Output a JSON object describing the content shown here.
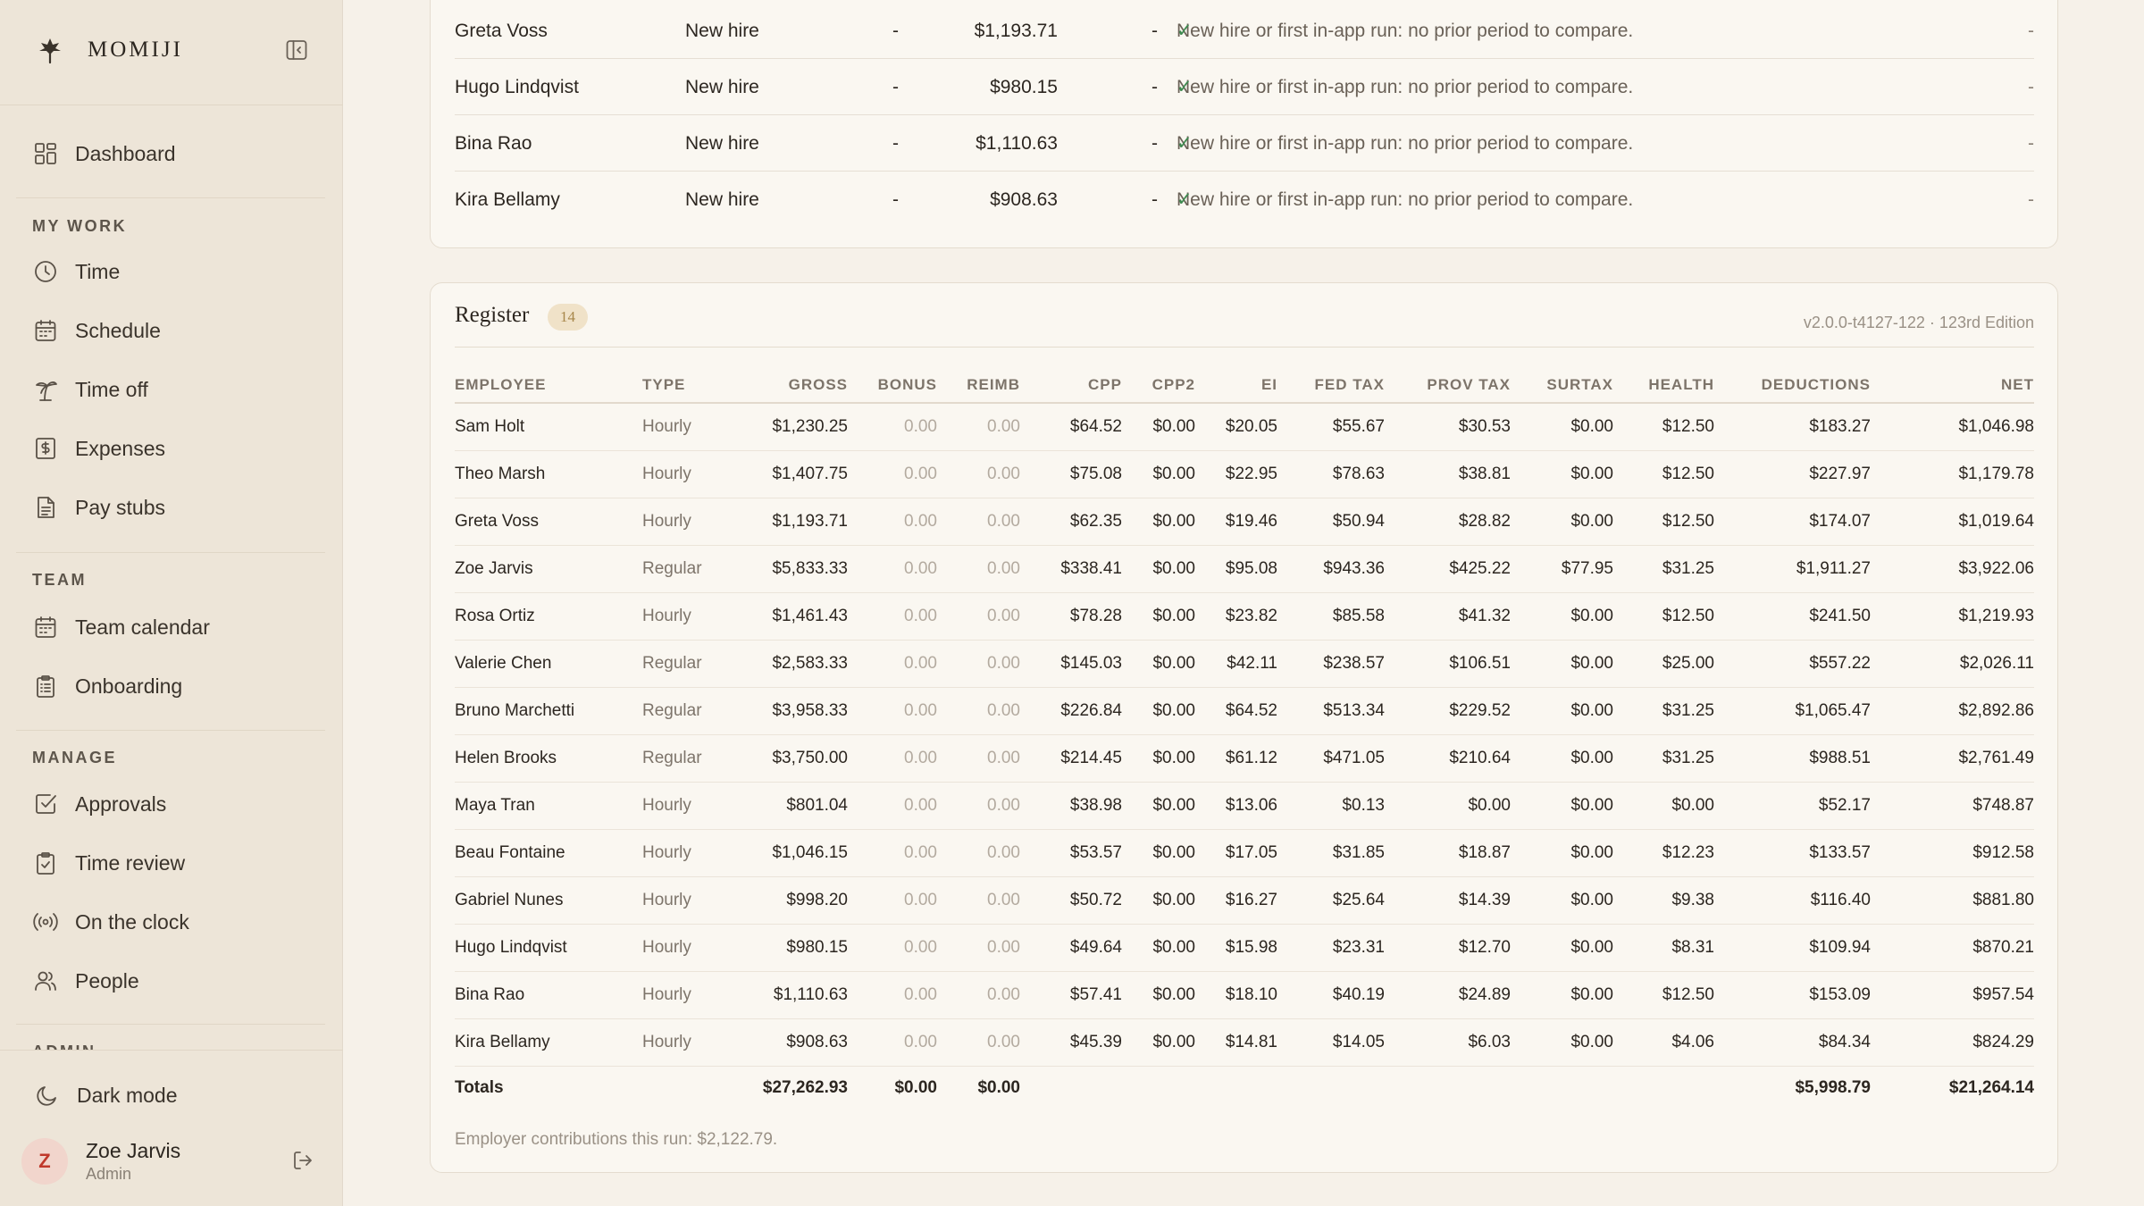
{
  "brand": {
    "name": "MOMIJI"
  },
  "nav": {
    "dashboard": "Dashboard",
    "sections": {
      "my_work": "MY WORK",
      "team": "TEAM",
      "manage": "MANAGE",
      "admin_partial": "ADMIN"
    },
    "my_work": [
      "Time",
      "Schedule",
      "Time off",
      "Expenses",
      "Pay stubs"
    ],
    "team": [
      "Team calendar",
      "Onboarding"
    ],
    "manage": [
      "Approvals",
      "Time review",
      "On the clock",
      "People"
    ],
    "dark_mode": "Dark mode"
  },
  "user": {
    "initial": "Z",
    "name": "Zoe Jarvis",
    "role": "Admin"
  },
  "comparison_rows": [
    {
      "name": "Greta Voss",
      "type": "New hire",
      "dash1": "-",
      "amount": "$1,193.71",
      "dash2": "-",
      "note": "New hire or first in-app run: no prior period to compare.",
      "end": "-"
    },
    {
      "name": "Hugo Lindqvist",
      "type": "New hire",
      "dash1": "-",
      "amount": "$980.15",
      "dash2": "-",
      "note": "New hire or first in-app run: no prior period to compare.",
      "end": "-"
    },
    {
      "name": "Bina Rao",
      "type": "New hire",
      "dash1": "-",
      "amount": "$1,110.63",
      "dash2": "-",
      "note": "New hire or first in-app run: no prior period to compare.",
      "end": "-"
    },
    {
      "name": "Kira Bellamy",
      "type": "New hire",
      "dash1": "-",
      "amount": "$908.63",
      "dash2": "-",
      "note": "New hire or first in-app run: no prior period to compare.",
      "end": "-"
    }
  ],
  "register": {
    "title": "Register",
    "count": "14",
    "version": "v2.0.0-t4127-122 · 123rd Edition",
    "columns": [
      "EMPLOYEE",
      "TYPE",
      "GROSS",
      "BONUS",
      "REIMB",
      "CPP",
      "CPP2",
      "EI",
      "FED TAX",
      "PROV TAX",
      "SURTAX",
      "HEALTH",
      "DEDUCTIONS",
      "NET"
    ],
    "rows": [
      [
        "Sam Holt",
        "Hourly",
        "$1,230.25",
        "0.00",
        "0.00",
        "$64.52",
        "$0.00",
        "$20.05",
        "$55.67",
        "$30.53",
        "$0.00",
        "$12.50",
        "$183.27",
        "$1,046.98"
      ],
      [
        "Theo Marsh",
        "Hourly",
        "$1,407.75",
        "0.00",
        "0.00",
        "$75.08",
        "$0.00",
        "$22.95",
        "$78.63",
        "$38.81",
        "$0.00",
        "$12.50",
        "$227.97",
        "$1,179.78"
      ],
      [
        "Greta Voss",
        "Hourly",
        "$1,193.71",
        "0.00",
        "0.00",
        "$62.35",
        "$0.00",
        "$19.46",
        "$50.94",
        "$28.82",
        "$0.00",
        "$12.50",
        "$174.07",
        "$1,019.64"
      ],
      [
        "Zoe Jarvis",
        "Regular",
        "$5,833.33",
        "0.00",
        "0.00",
        "$338.41",
        "$0.00",
        "$95.08",
        "$943.36",
        "$425.22",
        "$77.95",
        "$31.25",
        "$1,911.27",
        "$3,922.06"
      ],
      [
        "Rosa Ortiz",
        "Hourly",
        "$1,461.43",
        "0.00",
        "0.00",
        "$78.28",
        "$0.00",
        "$23.82",
        "$85.58",
        "$41.32",
        "$0.00",
        "$12.50",
        "$241.50",
        "$1,219.93"
      ],
      [
        "Valerie Chen",
        "Regular",
        "$2,583.33",
        "0.00",
        "0.00",
        "$145.03",
        "$0.00",
        "$42.11",
        "$238.57",
        "$106.51",
        "$0.00",
        "$25.00",
        "$557.22",
        "$2,026.11"
      ],
      [
        "Bruno Marchetti",
        "Regular",
        "$3,958.33",
        "0.00",
        "0.00",
        "$226.84",
        "$0.00",
        "$64.52",
        "$513.34",
        "$229.52",
        "$0.00",
        "$31.25",
        "$1,065.47",
        "$2,892.86"
      ],
      [
        "Helen Brooks",
        "Regular",
        "$3,750.00",
        "0.00",
        "0.00",
        "$214.45",
        "$0.00",
        "$61.12",
        "$471.05",
        "$210.64",
        "$0.00",
        "$31.25",
        "$988.51",
        "$2,761.49"
      ],
      [
        "Maya Tran",
        "Hourly",
        "$801.04",
        "0.00",
        "0.00",
        "$38.98",
        "$0.00",
        "$13.06",
        "$0.13",
        "$0.00",
        "$0.00",
        "$0.00",
        "$52.17",
        "$748.87"
      ],
      [
        "Beau Fontaine",
        "Hourly",
        "$1,046.15",
        "0.00",
        "0.00",
        "$53.57",
        "$0.00",
        "$17.05",
        "$31.85",
        "$18.87",
        "$0.00",
        "$12.23",
        "$133.57",
        "$912.58"
      ],
      [
        "Gabriel Nunes",
        "Hourly",
        "$998.20",
        "0.00",
        "0.00",
        "$50.72",
        "$0.00",
        "$16.27",
        "$25.64",
        "$14.39",
        "$0.00",
        "$9.38",
        "$116.40",
        "$881.80"
      ],
      [
        "Hugo Lindqvist",
        "Hourly",
        "$980.15",
        "0.00",
        "0.00",
        "$49.64",
        "$0.00",
        "$15.98",
        "$23.31",
        "$12.70",
        "$0.00",
        "$8.31",
        "$109.94",
        "$870.21"
      ],
      [
        "Bina Rao",
        "Hourly",
        "$1,110.63",
        "0.00",
        "0.00",
        "$57.41",
        "$0.00",
        "$18.10",
        "$40.19",
        "$24.89",
        "$0.00",
        "$12.50",
        "$153.09",
        "$957.54"
      ],
      [
        "Kira Bellamy",
        "Hourly",
        "$908.63",
        "0.00",
        "0.00",
        "$45.39",
        "$0.00",
        "$14.81",
        "$14.05",
        "$6.03",
        "$0.00",
        "$4.06",
        "$84.34",
        "$824.29"
      ]
    ],
    "totals": {
      "label": "Totals",
      "gross": "$27,262.93",
      "bonus": "$0.00",
      "reimb": "$0.00",
      "deductions": "$5,998.79",
      "net": "$21,264.14"
    },
    "employer_note": "Employer contributions this run: $2,122.79."
  },
  "colors": {
    "sidebar_bg": "#ede5d8",
    "page_bg": "#f6f1e9",
    "card_bg": "#faf7f1",
    "check": "#3d8a4f",
    "avatar_text": "#c0392b",
    "badge_bg": "#f0e2c8"
  }
}
